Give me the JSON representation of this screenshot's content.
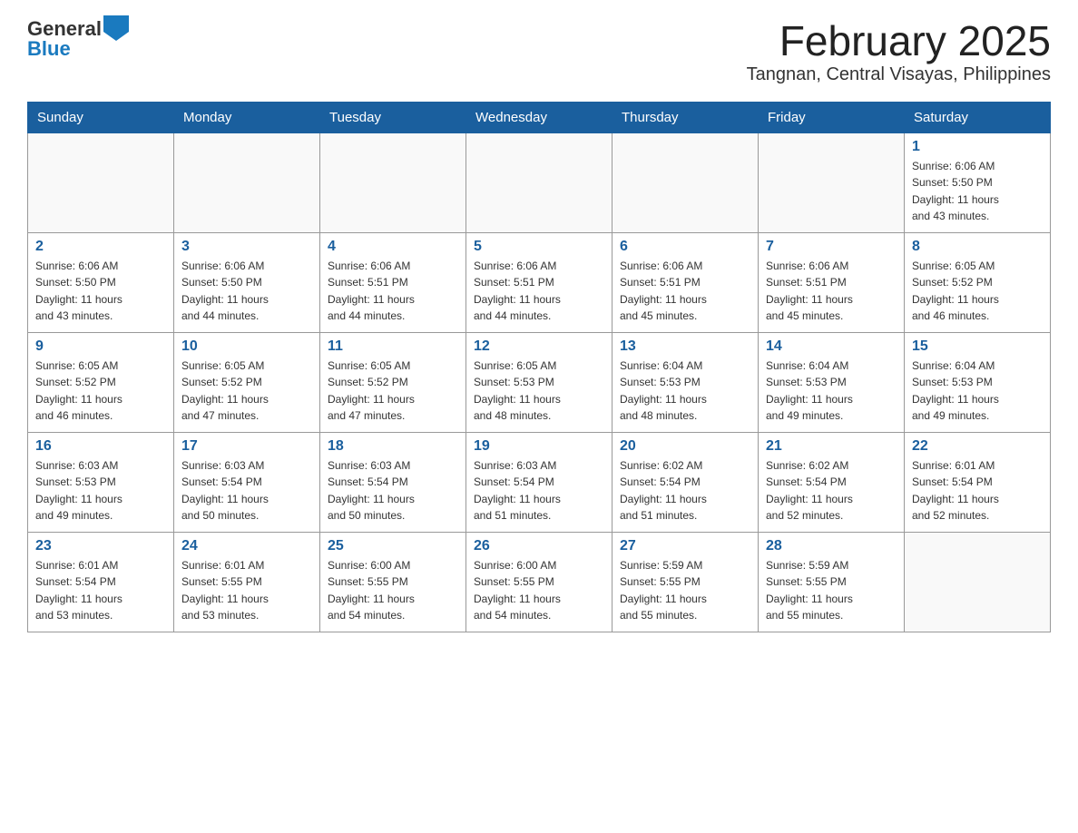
{
  "header": {
    "logo_general": "General",
    "logo_blue": "Blue",
    "title": "February 2025",
    "subtitle": "Tangnan, Central Visayas, Philippines"
  },
  "weekdays": [
    "Sunday",
    "Monday",
    "Tuesday",
    "Wednesday",
    "Thursday",
    "Friday",
    "Saturday"
  ],
  "weeks": [
    [
      {
        "day": "",
        "info": ""
      },
      {
        "day": "",
        "info": ""
      },
      {
        "day": "",
        "info": ""
      },
      {
        "day": "",
        "info": ""
      },
      {
        "day": "",
        "info": ""
      },
      {
        "day": "",
        "info": ""
      },
      {
        "day": "1",
        "info": "Sunrise: 6:06 AM\nSunset: 5:50 PM\nDaylight: 11 hours\nand 43 minutes."
      }
    ],
    [
      {
        "day": "2",
        "info": "Sunrise: 6:06 AM\nSunset: 5:50 PM\nDaylight: 11 hours\nand 43 minutes."
      },
      {
        "day": "3",
        "info": "Sunrise: 6:06 AM\nSunset: 5:50 PM\nDaylight: 11 hours\nand 44 minutes."
      },
      {
        "day": "4",
        "info": "Sunrise: 6:06 AM\nSunset: 5:51 PM\nDaylight: 11 hours\nand 44 minutes."
      },
      {
        "day": "5",
        "info": "Sunrise: 6:06 AM\nSunset: 5:51 PM\nDaylight: 11 hours\nand 44 minutes."
      },
      {
        "day": "6",
        "info": "Sunrise: 6:06 AM\nSunset: 5:51 PM\nDaylight: 11 hours\nand 45 minutes."
      },
      {
        "day": "7",
        "info": "Sunrise: 6:06 AM\nSunset: 5:51 PM\nDaylight: 11 hours\nand 45 minutes."
      },
      {
        "day": "8",
        "info": "Sunrise: 6:05 AM\nSunset: 5:52 PM\nDaylight: 11 hours\nand 46 minutes."
      }
    ],
    [
      {
        "day": "9",
        "info": "Sunrise: 6:05 AM\nSunset: 5:52 PM\nDaylight: 11 hours\nand 46 minutes."
      },
      {
        "day": "10",
        "info": "Sunrise: 6:05 AM\nSunset: 5:52 PM\nDaylight: 11 hours\nand 47 minutes."
      },
      {
        "day": "11",
        "info": "Sunrise: 6:05 AM\nSunset: 5:52 PM\nDaylight: 11 hours\nand 47 minutes."
      },
      {
        "day": "12",
        "info": "Sunrise: 6:05 AM\nSunset: 5:53 PM\nDaylight: 11 hours\nand 48 minutes."
      },
      {
        "day": "13",
        "info": "Sunrise: 6:04 AM\nSunset: 5:53 PM\nDaylight: 11 hours\nand 48 minutes."
      },
      {
        "day": "14",
        "info": "Sunrise: 6:04 AM\nSunset: 5:53 PM\nDaylight: 11 hours\nand 49 minutes."
      },
      {
        "day": "15",
        "info": "Sunrise: 6:04 AM\nSunset: 5:53 PM\nDaylight: 11 hours\nand 49 minutes."
      }
    ],
    [
      {
        "day": "16",
        "info": "Sunrise: 6:03 AM\nSunset: 5:53 PM\nDaylight: 11 hours\nand 49 minutes."
      },
      {
        "day": "17",
        "info": "Sunrise: 6:03 AM\nSunset: 5:54 PM\nDaylight: 11 hours\nand 50 minutes."
      },
      {
        "day": "18",
        "info": "Sunrise: 6:03 AM\nSunset: 5:54 PM\nDaylight: 11 hours\nand 50 minutes."
      },
      {
        "day": "19",
        "info": "Sunrise: 6:03 AM\nSunset: 5:54 PM\nDaylight: 11 hours\nand 51 minutes."
      },
      {
        "day": "20",
        "info": "Sunrise: 6:02 AM\nSunset: 5:54 PM\nDaylight: 11 hours\nand 51 minutes."
      },
      {
        "day": "21",
        "info": "Sunrise: 6:02 AM\nSunset: 5:54 PM\nDaylight: 11 hours\nand 52 minutes."
      },
      {
        "day": "22",
        "info": "Sunrise: 6:01 AM\nSunset: 5:54 PM\nDaylight: 11 hours\nand 52 minutes."
      }
    ],
    [
      {
        "day": "23",
        "info": "Sunrise: 6:01 AM\nSunset: 5:54 PM\nDaylight: 11 hours\nand 53 minutes."
      },
      {
        "day": "24",
        "info": "Sunrise: 6:01 AM\nSunset: 5:55 PM\nDaylight: 11 hours\nand 53 minutes."
      },
      {
        "day": "25",
        "info": "Sunrise: 6:00 AM\nSunset: 5:55 PM\nDaylight: 11 hours\nand 54 minutes."
      },
      {
        "day": "26",
        "info": "Sunrise: 6:00 AM\nSunset: 5:55 PM\nDaylight: 11 hours\nand 54 minutes."
      },
      {
        "day": "27",
        "info": "Sunrise: 5:59 AM\nSunset: 5:55 PM\nDaylight: 11 hours\nand 55 minutes."
      },
      {
        "day": "28",
        "info": "Sunrise: 5:59 AM\nSunset: 5:55 PM\nDaylight: 11 hours\nand 55 minutes."
      },
      {
        "day": "",
        "info": ""
      }
    ]
  ]
}
